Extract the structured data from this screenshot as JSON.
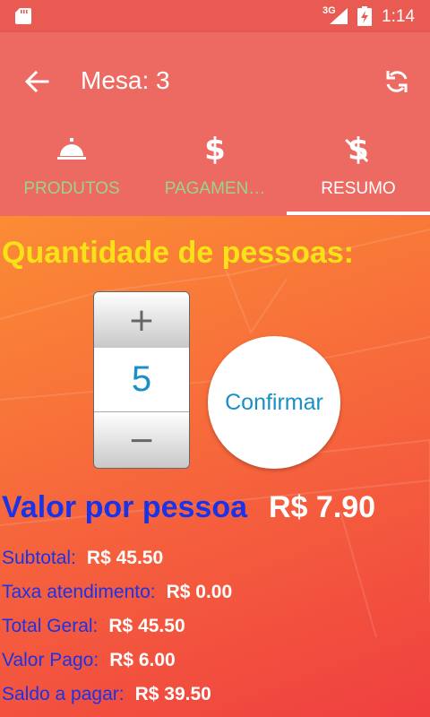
{
  "status_bar": {
    "network": "3G",
    "time": "1:14"
  },
  "app_bar": {
    "title": "Mesa: 3"
  },
  "tabs": [
    {
      "label": "PRODUTOS",
      "icon": "bell-icon"
    },
    {
      "label": "PAGAMEN…",
      "icon": "dollar-icon"
    },
    {
      "label": "RESUMO",
      "icon": "dollar-off-icon"
    }
  ],
  "quantity": {
    "title": "Quantidade de pessoas:",
    "increment_symbol": "+",
    "value": "5",
    "decrement_symbol": "−",
    "confirm_label": "Confirmar"
  },
  "per_person": {
    "label": "Valor por pessoa",
    "value": "R$ 7.90"
  },
  "summary": [
    {
      "label": "Subtotal:",
      "value": "R$ 45.50"
    },
    {
      "label": "Taxa atendimento:",
      "value": "R$ 0.00"
    },
    {
      "label": "Total Geral:",
      "value": "R$ 45.50"
    },
    {
      "label": "Valor Pago:",
      "value": "R$ 6.00"
    },
    {
      "label": "Saldo a pagar:",
      "value": "R$ 39.50"
    }
  ],
  "colors": {
    "app_bar": "#ec6a62",
    "tab_inactive_text": "#9bd28e",
    "heading_yellow": "#f7e217",
    "label_blue": "#1a33e8",
    "stepper_value": "#1a8fc7"
  }
}
